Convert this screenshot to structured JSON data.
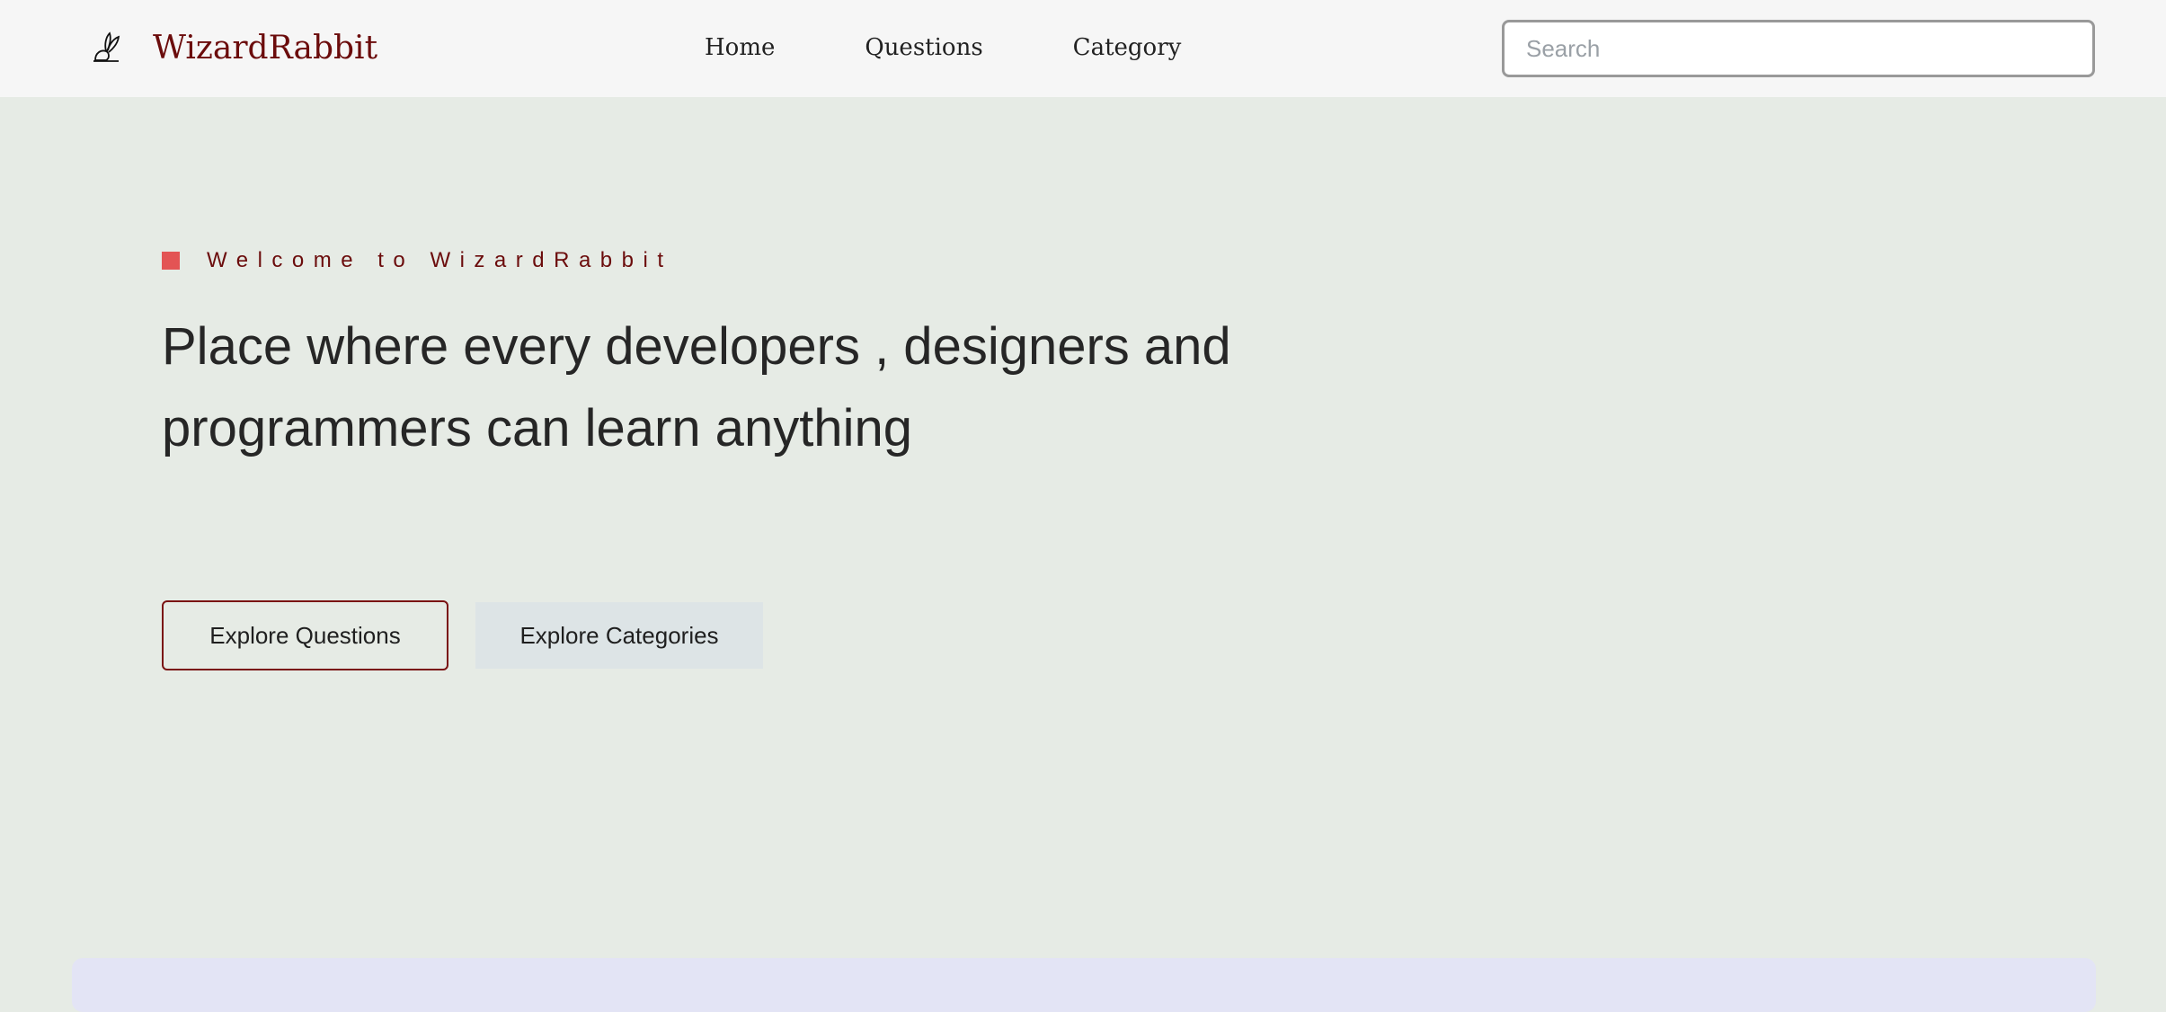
{
  "navbar": {
    "brand": "WizardRabbit",
    "links": [
      "Home",
      "Questions",
      "Category"
    ],
    "search_placeholder": "Search"
  },
  "hero": {
    "eyebrow": "Welcome to WizardRabbit",
    "headline": "Place where every developers , designers and programmers can learn anything",
    "primary_button": "Explore Questions",
    "secondary_button": "Explore Categories"
  },
  "colors": {
    "brand": "#6b0c0c",
    "accent": "#e35454",
    "page_background": "#e6ebe5",
    "nav_background": "#f6f6f6",
    "secondary_button_bg": "#dde4e6",
    "bottom_card_bg": "#e3e4f5"
  },
  "icons": {
    "logo": "rabbit-logo-icon"
  }
}
